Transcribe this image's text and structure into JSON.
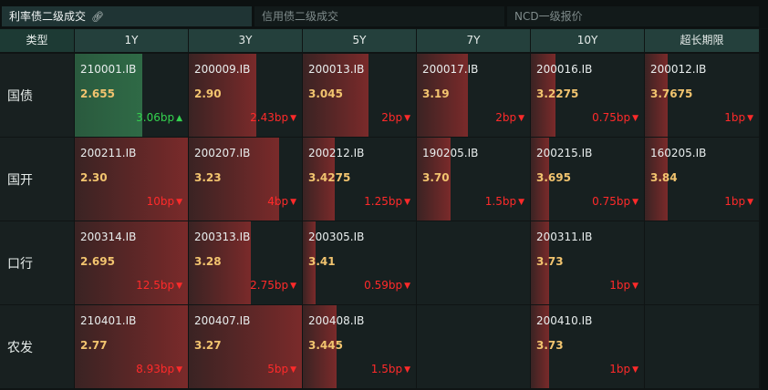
{
  "tabs": [
    {
      "label": "利率债二级成交",
      "active": true
    },
    {
      "label": "信用债二级成交",
      "active": false
    },
    {
      "label": "NCD一级报价",
      "active": false
    }
  ],
  "columns": [
    "类型",
    "1Y",
    "3Y",
    "5Y",
    "7Y",
    "10Y",
    "超长期限"
  ],
  "rows": [
    {
      "label": "国债",
      "cells": [
        {
          "code": "210001.IB",
          "yield": "2.655",
          "change": "3.06bp",
          "dir": "up",
          "intensity": 0.6
        },
        {
          "code": "200009.IB",
          "yield": "2.90",
          "change": "2.43bp",
          "dir": "down",
          "intensity": 0.6
        },
        {
          "code": "200013.IB",
          "yield": "3.045",
          "change": "2bp",
          "dir": "down",
          "intensity": 0.58
        },
        {
          "code": "200017.IB",
          "yield": "3.19",
          "change": "2bp",
          "dir": "down",
          "intensity": 0.45
        },
        {
          "code": "200016.IB",
          "yield": "3.2275",
          "change": "0.75bp",
          "dir": "down",
          "intensity": 0.22
        },
        {
          "code": "200012.IB",
          "yield": "3.7675",
          "change": "1bp",
          "dir": "down",
          "intensity": 0.2
        }
      ]
    },
    {
      "label": "国开",
      "cells": [
        {
          "code": "200211.IB",
          "yield": "2.30",
          "change": "10bp",
          "dir": "down",
          "intensity": 1.0
        },
        {
          "code": "200207.IB",
          "yield": "3.23",
          "change": "4bp",
          "dir": "down",
          "intensity": 0.8
        },
        {
          "code": "200212.IB",
          "yield": "3.4275",
          "change": "1.25bp",
          "dir": "down",
          "intensity": 0.28
        },
        {
          "code": "190205.IB",
          "yield": "3.70",
          "change": "1.5bp",
          "dir": "down",
          "intensity": 0.3
        },
        {
          "code": "200215.IB",
          "yield": "3.695",
          "change": "0.75bp",
          "dir": "down",
          "intensity": 0.16
        },
        {
          "code": "160205.IB",
          "yield": "3.84",
          "change": "1bp",
          "dir": "down",
          "intensity": 0.2
        }
      ]
    },
    {
      "label": "口行",
      "cells": [
        {
          "code": "200314.IB",
          "yield": "2.695",
          "change": "12.5bp",
          "dir": "down",
          "intensity": 1.0
        },
        {
          "code": "200313.IB",
          "yield": "3.28",
          "change": "2.75bp",
          "dir": "down",
          "intensity": 0.55
        },
        {
          "code": "200305.IB",
          "yield": "3.41",
          "change": "0.59bp",
          "dir": "down",
          "intensity": 0.11
        },
        null,
        {
          "code": "200311.IB",
          "yield": "3.73",
          "change": "1bp",
          "dir": "down",
          "intensity": 0.16
        },
        null
      ]
    },
    {
      "label": "农发",
      "cells": [
        {
          "code": "210401.IB",
          "yield": "2.77",
          "change": "8.93bp",
          "dir": "down",
          "intensity": 1.0
        },
        {
          "code": "200407.IB",
          "yield": "3.27",
          "change": "5bp",
          "dir": "down",
          "intensity": 1.0
        },
        {
          "code": "200408.IB",
          "yield": "3.445",
          "change": "1.5bp",
          "dir": "down",
          "intensity": 0.3
        },
        null,
        {
          "code": "200410.IB",
          "yield": "3.73",
          "change": "1bp",
          "dir": "down",
          "intensity": 0.16
        },
        null
      ]
    }
  ]
}
